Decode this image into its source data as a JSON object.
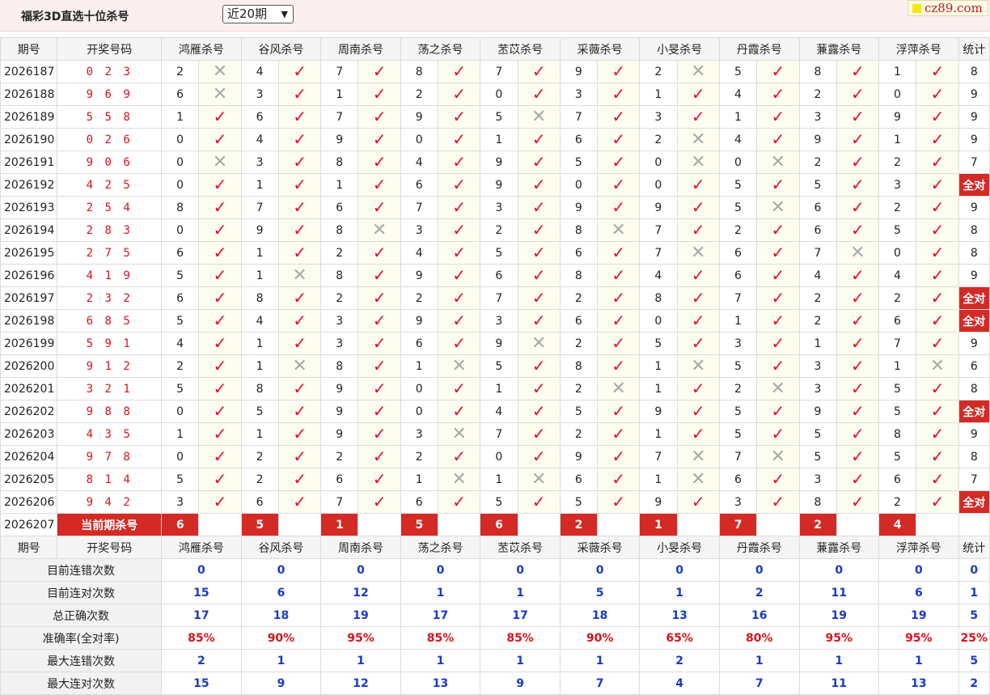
{
  "page": {
    "title": "福彩3D直选十位杀号",
    "period_select": "近20期",
    "logo": "cz89.com"
  },
  "headers": {
    "issue": "期号",
    "draw": "开奖号码",
    "experts": [
      "鸿雁杀号",
      "谷风杀号",
      "周南杀号",
      "荡之杀号",
      "苤苡杀号",
      "采薇杀号",
      "小旻杀号",
      "丹霞杀号",
      "蒹露杀号",
      "浮萍杀号"
    ],
    "stat": "统计"
  },
  "rows": [
    {
      "issue": "2026187",
      "draw": "0 2 3",
      "kills": [
        2,
        4,
        7,
        8,
        7,
        9,
        2,
        5,
        8,
        1
      ],
      "hits": [
        0,
        1,
        1,
        1,
        1,
        1,
        0,
        1,
        1,
        1
      ],
      "stat": "8"
    },
    {
      "issue": "2026188",
      "draw": "9 6 9",
      "kills": [
        6,
        3,
        1,
        2,
        0,
        3,
        1,
        4,
        2,
        0
      ],
      "hits": [
        0,
        1,
        1,
        1,
        1,
        1,
        1,
        1,
        1,
        1
      ],
      "stat": "9"
    },
    {
      "issue": "2026189",
      "draw": "5 5 8",
      "kills": [
        1,
        6,
        7,
        9,
        5,
        7,
        3,
        1,
        3,
        9
      ],
      "hits": [
        1,
        1,
        1,
        1,
        0,
        1,
        1,
        1,
        1,
        1
      ],
      "stat": "9"
    },
    {
      "issue": "2026190",
      "draw": "0 2 6",
      "kills": [
        0,
        4,
        9,
        0,
        1,
        6,
        2,
        4,
        9,
        1
      ],
      "hits": [
        1,
        1,
        1,
        1,
        1,
        1,
        0,
        1,
        1,
        1
      ],
      "stat": "9"
    },
    {
      "issue": "2026191",
      "draw": "9 0 6",
      "kills": [
        0,
        3,
        8,
        4,
        9,
        5,
        0,
        0,
        2,
        2
      ],
      "hits": [
        0,
        1,
        1,
        1,
        1,
        1,
        0,
        0,
        1,
        1
      ],
      "stat": "7"
    },
    {
      "issue": "2026192",
      "draw": "4 2 5",
      "kills": [
        0,
        1,
        1,
        6,
        9,
        0,
        0,
        5,
        5,
        3
      ],
      "hits": [
        1,
        1,
        1,
        1,
        1,
        1,
        1,
        1,
        1,
        1
      ],
      "stat": "全对"
    },
    {
      "issue": "2026193",
      "draw": "2 5 4",
      "kills": [
        8,
        7,
        6,
        7,
        3,
        9,
        9,
        5,
        6,
        2
      ],
      "hits": [
        1,
        1,
        1,
        1,
        1,
        1,
        1,
        0,
        1,
        1
      ],
      "stat": "9"
    },
    {
      "issue": "2026194",
      "draw": "2 8 3",
      "kills": [
        0,
        9,
        8,
        3,
        2,
        8,
        7,
        2,
        6,
        5
      ],
      "hits": [
        1,
        1,
        0,
        1,
        1,
        0,
        1,
        1,
        1,
        1
      ],
      "stat": "8"
    },
    {
      "issue": "2026195",
      "draw": "2 7 5",
      "kills": [
        6,
        1,
        2,
        4,
        5,
        6,
        7,
        6,
        7,
        0
      ],
      "hits": [
        1,
        1,
        1,
        1,
        1,
        1,
        0,
        1,
        0,
        1
      ],
      "stat": "8"
    },
    {
      "issue": "2026196",
      "draw": "4 1 9",
      "kills": [
        5,
        1,
        8,
        9,
        6,
        8,
        4,
        6,
        4,
        4
      ],
      "hits": [
        1,
        0,
        1,
        1,
        1,
        1,
        1,
        1,
        1,
        1
      ],
      "stat": "9"
    },
    {
      "issue": "2026197",
      "draw": "2 3 2",
      "kills": [
        6,
        8,
        2,
        2,
        7,
        2,
        8,
        7,
        2,
        2
      ],
      "hits": [
        1,
        1,
        1,
        1,
        1,
        1,
        1,
        1,
        1,
        1
      ],
      "stat": "全对"
    },
    {
      "issue": "2026198",
      "draw": "6 8 5",
      "kills": [
        5,
        4,
        3,
        9,
        3,
        6,
        0,
        1,
        2,
        6
      ],
      "hits": [
        1,
        1,
        1,
        1,
        1,
        1,
        1,
        1,
        1,
        1
      ],
      "stat": "全对"
    },
    {
      "issue": "2026199",
      "draw": "5 9 1",
      "kills": [
        4,
        1,
        3,
        6,
        9,
        2,
        5,
        3,
        1,
        7
      ],
      "hits": [
        1,
        1,
        1,
        1,
        0,
        1,
        1,
        1,
        1,
        1
      ],
      "stat": "9"
    },
    {
      "issue": "2026200",
      "draw": "9 1 2",
      "kills": [
        2,
        1,
        8,
        1,
        5,
        8,
        1,
        5,
        3,
        1
      ],
      "hits": [
        1,
        0,
        1,
        0,
        1,
        1,
        0,
        1,
        1,
        0
      ],
      "stat": "6"
    },
    {
      "issue": "2026201",
      "draw": "3 2 1",
      "kills": [
        5,
        8,
        9,
        0,
        1,
        2,
        1,
        2,
        3,
        5
      ],
      "hits": [
        1,
        1,
        1,
        1,
        1,
        0,
        1,
        0,
        1,
        1
      ],
      "stat": "8"
    },
    {
      "issue": "2026202",
      "draw": "9 8 8",
      "kills": [
        0,
        5,
        9,
        0,
        4,
        5,
        9,
        5,
        9,
        5
      ],
      "hits": [
        1,
        1,
        1,
        1,
        1,
        1,
        1,
        1,
        1,
        1
      ],
      "stat": "全对"
    },
    {
      "issue": "2026203",
      "draw": "4 3 5",
      "kills": [
        1,
        1,
        9,
        3,
        7,
        2,
        1,
        5,
        5,
        8
      ],
      "hits": [
        1,
        1,
        1,
        0,
        1,
        1,
        1,
        1,
        1,
        1
      ],
      "stat": "9"
    },
    {
      "issue": "2026204",
      "draw": "9 7 8",
      "kills": [
        0,
        2,
        2,
        2,
        0,
        9,
        7,
        7,
        5,
        5
      ],
      "hits": [
        1,
        1,
        1,
        1,
        1,
        1,
        0,
        0,
        1,
        1
      ],
      "stat": "8"
    },
    {
      "issue": "2026205",
      "draw": "8 1 4",
      "kills": [
        5,
        2,
        6,
        1,
        1,
        6,
        1,
        6,
        3,
        6
      ],
      "hits": [
        1,
        1,
        1,
        0,
        0,
        1,
        0,
        1,
        1,
        1
      ],
      "stat": "7"
    },
    {
      "issue": "2026206",
      "draw": "9 4 2",
      "kills": [
        3,
        6,
        7,
        6,
        5,
        5,
        9,
        3,
        8,
        2
      ],
      "hits": [
        1,
        1,
        1,
        1,
        1,
        1,
        1,
        1,
        1,
        1
      ],
      "stat": "全对"
    }
  ],
  "current": {
    "issue": "2026207",
    "label": "当前期杀号",
    "kills": [
      6,
      5,
      1,
      5,
      6,
      2,
      1,
      7,
      2,
      4
    ]
  },
  "summary": [
    {
      "label": "目前连错次数",
      "values": [
        "0",
        "0",
        "0",
        "0",
        "0",
        "0",
        "0",
        "0",
        "0",
        "0"
      ],
      "stat": "0",
      "type": "num"
    },
    {
      "label": "目前连对次数",
      "values": [
        "15",
        "6",
        "12",
        "1",
        "1",
        "5",
        "1",
        "2",
        "11",
        "6"
      ],
      "stat": "1",
      "type": "num"
    },
    {
      "label": "总正确次数",
      "values": [
        "17",
        "18",
        "19",
        "17",
        "17",
        "18",
        "13",
        "16",
        "19",
        "19"
      ],
      "stat": "5",
      "type": "num"
    },
    {
      "label": "准确率(全对率)",
      "values": [
        "85%",
        "90%",
        "95%",
        "85%",
        "85%",
        "90%",
        "65%",
        "80%",
        "95%",
        "95%"
      ],
      "stat": "25%",
      "type": "pct"
    },
    {
      "label": "最大连错次数",
      "values": [
        "2",
        "1",
        "1",
        "1",
        "1",
        "1",
        "2",
        "1",
        "1",
        "1"
      ],
      "stat": "5",
      "type": "num"
    },
    {
      "label": "最大连对次数",
      "values": [
        "15",
        "9",
        "12",
        "13",
        "9",
        "7",
        "4",
        "7",
        "11",
        "13"
      ],
      "stat": "2",
      "type": "num"
    }
  ],
  "marks": {
    "hit": "✓",
    "miss": "✕"
  },
  "colors": {
    "accent_red": "#d42a26",
    "hit": "#e4102a",
    "miss": "#aaaaaa",
    "summary_blue": "#1a3ac7"
  }
}
